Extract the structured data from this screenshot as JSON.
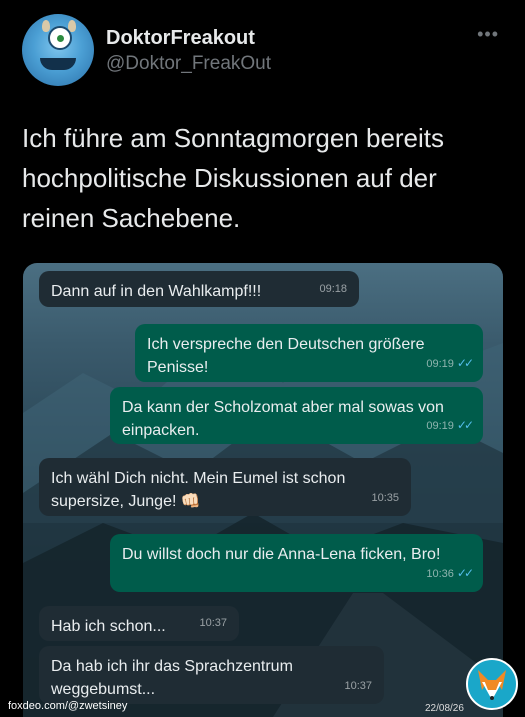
{
  "tweet": {
    "display_name": "DoktorFreakout",
    "handle": "@Doktor_FreakOut",
    "more_icon": "more-horizontal-icon",
    "text": "Ich führe am Sonntagmorgen bereits hochpolitische Diskussionen auf der reinen Sachebene."
  },
  "chat": {
    "messages": [
      {
        "dir": "in",
        "text": "Dann auf in den Wahlkampf!!!",
        "time": "09:18"
      },
      {
        "dir": "out",
        "text": "Ich verspreche den Deutschen größere Penisse!",
        "time": "09:19"
      },
      {
        "dir": "out",
        "text": "Da kann der Scholzomat aber mal sowas von einpacken.",
        "time": "09:19"
      },
      {
        "dir": "in",
        "text": "Ich wähl Dich nicht. Mein Eumel ist schon supersize, Junge! 👊🏻",
        "time": "10:35"
      },
      {
        "dir": "out",
        "text": "Du willst doch nur die Anna-Lena ficken, Bro!",
        "time": "10:36"
      },
      {
        "dir": "in",
        "text": "Hab ich schon...",
        "time": "10:37"
      },
      {
        "dir": "in",
        "text": "Da hab ich ihr das Sprachzentrum weggebumst...",
        "time": "10:37"
      }
    ],
    "read_ticks": "✓✓",
    "colors": {
      "incoming": "#1f2c34",
      "outgoing": "#005c4b",
      "ticks": "#53bdeb"
    }
  },
  "watermark": {
    "left": "foxdeo.com/@zwetsiney",
    "right": "22/08/26"
  }
}
